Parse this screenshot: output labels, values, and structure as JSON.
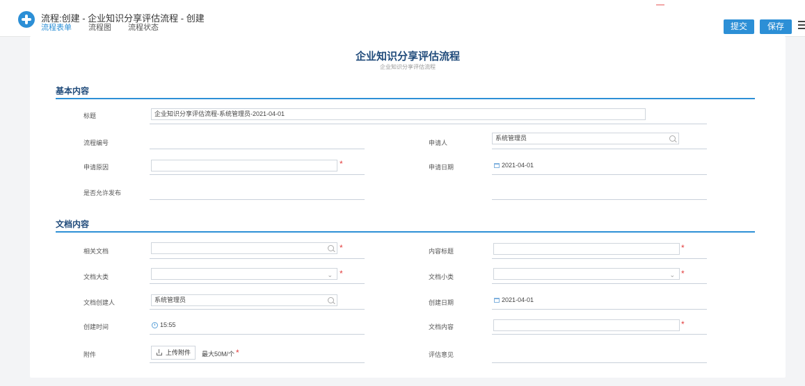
{
  "window": {
    "title": "流程:创建 - 企业知识分享评估流程 - 创建"
  },
  "tabs": [
    {
      "label": "流程表单",
      "active": true
    },
    {
      "label": "流程图",
      "active": false
    },
    {
      "label": "流程状态",
      "active": false
    }
  ],
  "toolbar": {
    "submit_label": "提交",
    "save_label": "保存"
  },
  "form": {
    "title": "企业知识分享评估流程",
    "subtitle": "企业知识分享评估流程"
  },
  "basic": {
    "section_title": "基本内容",
    "title_label": "标题",
    "title_value": "企业知识分享评估流程-系统管理员-2021-04-01",
    "process_no_label": "流程编号",
    "applicant_label": "申请人",
    "applicant_value": "系统管理员",
    "reason_label": "申请原因",
    "apply_date_label": "申请日期",
    "apply_date_value": "2021-04-01",
    "allow_publish_label": "是否允许发布"
  },
  "docs": {
    "section_title": "文档内容",
    "related_doc_label": "相关文档",
    "content_title_label": "内容标题",
    "category_label": "文档大类",
    "subcategory_label": "文档小类",
    "creator_label": "文档创建人",
    "creator_value": "系统管理员",
    "create_date_label": "创建日期",
    "create_date_value": "2021-04-01",
    "create_time_label": "创建时间",
    "create_time_value": "15:55",
    "content_label": "文档内容",
    "attachment_label": "附件",
    "upload_label": "上传附件",
    "upload_limit": "最大50M/个",
    "opinion_label": "评估意见"
  },
  "required_mark": "*",
  "colors": {
    "accent": "#2c8fd6",
    "heading": "#1f4a7a",
    "required": "#e23c3c"
  }
}
